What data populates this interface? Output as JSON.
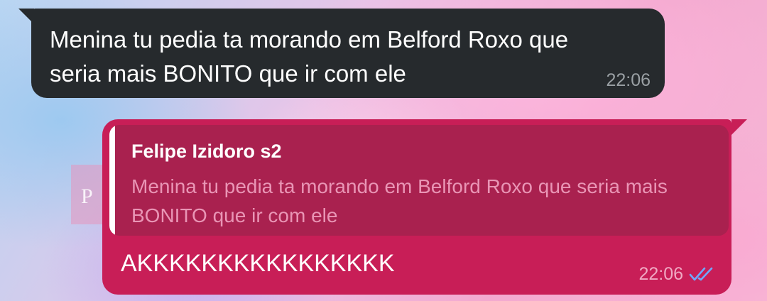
{
  "colors": {
    "incoming_bubble": "#262a2d",
    "outgoing_bubble": "#c81e57",
    "reply_block": "#a9214f",
    "read_ticks": "#6fa8ff"
  },
  "wallpaper": {
    "label": "P"
  },
  "incoming": {
    "text": "Menina tu pedia ta morando em Belford Roxo que seria mais BONITO que ir com ele",
    "time": "22:06"
  },
  "outgoing": {
    "reply": {
      "author": "Felipe Izidoro s2",
      "text": "Menina tu pedia ta morando em Belford Roxo que seria mais BONITO que ir com ele"
    },
    "text": "AKKKKKKKKKKKKKKKK",
    "time": "22:06",
    "status_icon": "double-check-read-icon"
  }
}
